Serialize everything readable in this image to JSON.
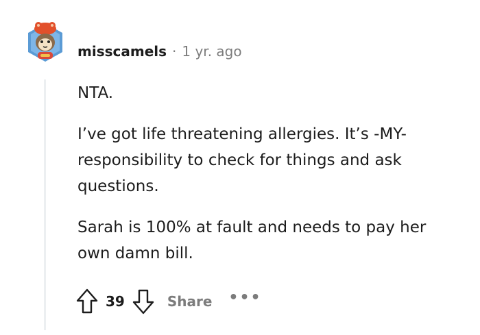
{
  "comment": {
    "username": "misscamels",
    "separator": "·",
    "timestamp": "1 yr. ago",
    "paragraphs": [
      "NTA.",
      "I’ve got life threatening allergies. It’s -MY- responsibility to check for things and ask questions.",
      "Sarah is 100% at fault and needs to pay her own damn bill."
    ],
    "score": "39",
    "share_label": "Share",
    "more_label": "•••"
  },
  "icons": {
    "avatar": "snoo-avatar-icon",
    "upvote": "upvote-arrow-icon",
    "downvote": "downvote-arrow-icon",
    "more": "more-options-icon"
  },
  "colors": {
    "text": "#1c1c1c",
    "meta": "#7c7c7c",
    "thread_line": "#eceff1",
    "avatar_bg": "#5b9bd5"
  }
}
